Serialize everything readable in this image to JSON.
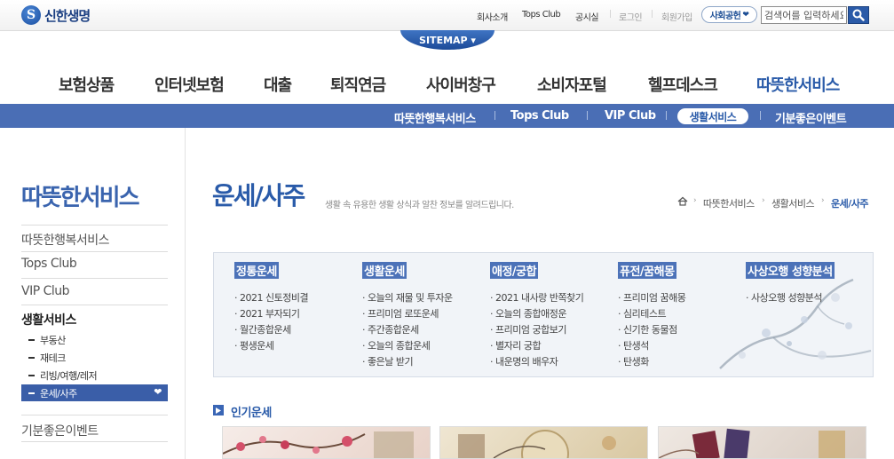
{
  "brand": {
    "logo_text": "신한생명",
    "logo_mark": "S"
  },
  "util_links": {
    "company": "회사소개",
    "tops_club": "Tops Club",
    "notice": "공시실",
    "login": "로그인",
    "join": "회원가입",
    "social": "사회공헌"
  },
  "search": {
    "value": "검색어를 입력하세요"
  },
  "sitemap": "SITEMAP ▾",
  "gnb": [
    "보험상품",
    "인터넷보험",
    "대출",
    "퇴직연금",
    "사이버창구",
    "소비자포털",
    "헬프데스크",
    "따뜻한서비스"
  ],
  "subnav": [
    "따뜻한행복서비스",
    "Tops Club",
    "VIP Club",
    "생활서비스",
    "기분좋은이벤트"
  ],
  "lnb": {
    "title": "따뜻한서비스",
    "items": [
      "따뜻한행복서비스",
      "Tops Club",
      "VIP Club",
      "생활서비스",
      "기분좋은이벤트"
    ],
    "sub_items": [
      "부동산",
      "재테크",
      "리빙/여행/레저",
      "운세/사주"
    ]
  },
  "page": {
    "title": "운세/사주",
    "desc": "생활 속 유용한 생활 상식과 알찬 정보를 알려드립니다.",
    "breadcrumb": [
      "따뜻한서비스",
      "생활서비스",
      "운세/사주"
    ]
  },
  "services": [
    {
      "head": "정통운세",
      "items": [
        "· 2021 신토정비결",
        "· 2021 부자되기",
        "· 월간종합운세",
        "· 평생운세"
      ]
    },
    {
      "head": "생활운세",
      "items": [
        "· 오늘의 재물 및 투자운",
        "· 프리미엄 로또운세",
        "· 주간종합운세",
        "· 오늘의 종합운세",
        "· 좋은날 받기"
      ]
    },
    {
      "head": "애정/궁합",
      "items": [
        "· 2021 내사랑 반쪽찾기",
        "· 오늘의 종합애정운",
        "· 프리미엄 궁합보기",
        "· 별자리 궁합",
        "· 내운명의 배우자"
      ]
    },
    {
      "head": "퓨전/꿈해몽",
      "items": [
        "· 프리미엄 꿈해몽",
        "· 심리테스트",
        "· 신기한 동물점",
        "· 탄생석",
        "· 탄생화"
      ]
    },
    {
      "head": "사상오행 성향분석",
      "items": [
        "· 사상오행 성향분석"
      ]
    }
  ],
  "popular": {
    "title": "인기운세"
  },
  "colors": {
    "brand_blue": "#2a5ba9",
    "subnav_bg": "#4a6eb5",
    "lnb_active": "#3a5ea8"
  }
}
